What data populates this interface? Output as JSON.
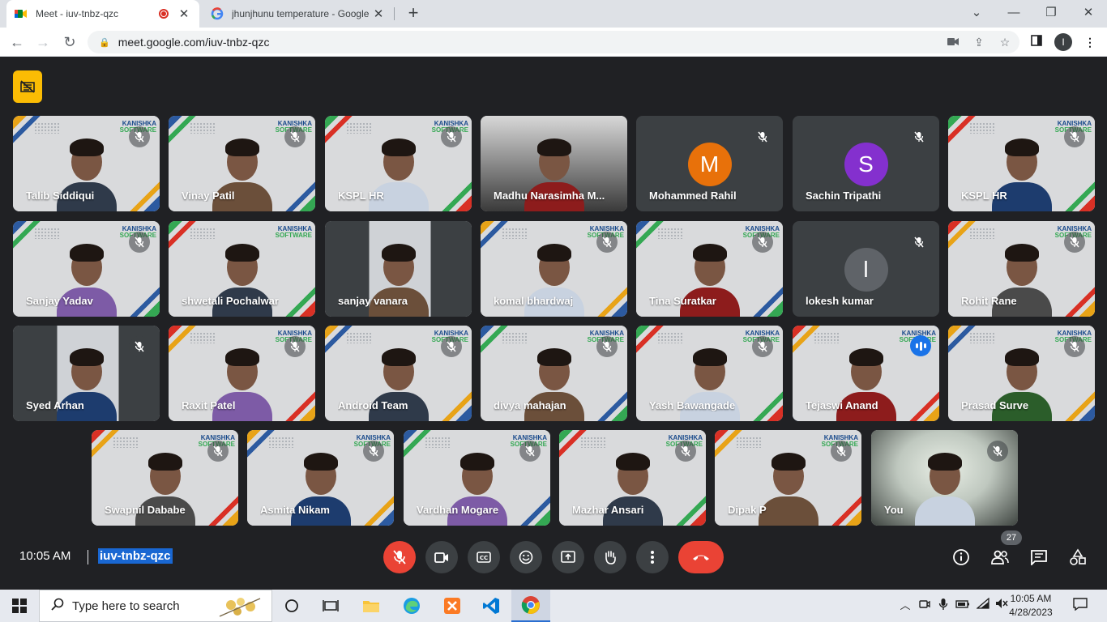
{
  "browser": {
    "tabs": [
      {
        "title": "Meet - iuv-tnbz-qzc",
        "active": true,
        "recording": true
      },
      {
        "title": "jhunjhunu temperature - Google",
        "active": false
      }
    ],
    "url": "meet.google.com/iuv-tnbz-qzc",
    "profile_initial": "I"
  },
  "meet": {
    "participants_row1": [
      {
        "name": "Talib Siddiqui",
        "muted": true
      },
      {
        "name": "Vinay Patil",
        "muted": true
      },
      {
        "name": "KSPL HR",
        "muted": true
      },
      {
        "name": "Madhu Narasimha M...",
        "muted": false
      },
      {
        "name": "Mohammed Rahil",
        "muted": true,
        "avatar": "M",
        "avatar_color": "#e8710a"
      },
      {
        "name": "Sachin Tripathi",
        "muted": true,
        "avatar": "S",
        "avatar_color": "#8430ce"
      },
      {
        "name": "KSPL HR",
        "muted": true
      }
    ],
    "participants_row2": [
      {
        "name": "Sanjay Yadav",
        "muted": true
      },
      {
        "name": "shwetali Pochalwar",
        "muted": false
      },
      {
        "name": "sanjay vanara",
        "muted": false
      },
      {
        "name": "komal bhardwaj",
        "muted": true
      },
      {
        "name": "Tina Suratkar",
        "muted": true
      },
      {
        "name": "lokesh kumar",
        "muted": true,
        "avatar": "l",
        "avatar_color": "#5f6368"
      },
      {
        "name": "Rohit Rane",
        "muted": true
      }
    ],
    "participants_row3": [
      {
        "name": "Syed Arhan",
        "muted": true
      },
      {
        "name": "Raxit Patel",
        "muted": true
      },
      {
        "name": "Android Team",
        "muted": true
      },
      {
        "name": "divya mahajan",
        "muted": true
      },
      {
        "name": "Yash Bawangade",
        "muted": true
      },
      {
        "name": "Tejaswi Anand",
        "muted": false,
        "speaking": true
      },
      {
        "name": "Prasad Surve",
        "muted": true
      }
    ],
    "participants_row4": [
      {
        "name": "Swapnil Dababe",
        "muted": true
      },
      {
        "name": "Asmita Nikam",
        "muted": true
      },
      {
        "name": "Vardhan Mogare",
        "muted": true
      },
      {
        "name": "Mazhar Ansari",
        "muted": true
      },
      {
        "name": "Dipak P",
        "muted": true
      },
      {
        "name": "You",
        "muted": true
      }
    ],
    "brand_text_1": "KANISHKA",
    "brand_text_2": "SOFTWARE",
    "time": "10:05 AM",
    "meeting_code": "iuv-tnbz-qzc",
    "participant_count": "27"
  },
  "taskbar": {
    "search_placeholder": "Type here to search",
    "clock_time": "10:05 AM",
    "clock_date": "4/28/2023"
  },
  "colors": {
    "meet_bg": "#202124",
    "hangup_red": "#ea4335",
    "highlight_blue": "#1967d2",
    "speaking_blue": "#8ab4f8"
  }
}
